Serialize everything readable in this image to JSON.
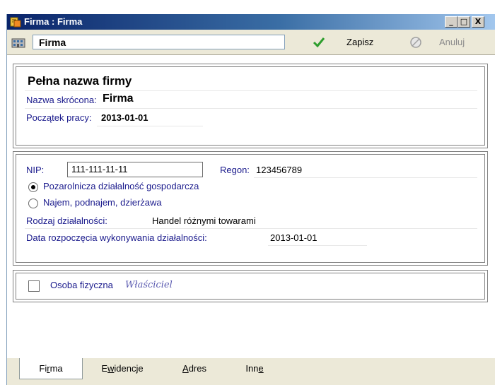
{
  "window": {
    "title": "Firma : Firma",
    "controls": [
      "_",
      "□",
      "X"
    ]
  },
  "toolbar": {
    "name_value": "Firma",
    "save_label": "Zapisz",
    "cancel_label": "Anuluj"
  },
  "company": {
    "full_name": "Pełna nazwa firmy",
    "short_name_label": "Nazwa skrócona:",
    "short_name_value": "Firma",
    "start_label": "Początek pracy:",
    "start_value": "2013-01-01"
  },
  "tax": {
    "nip_label": "NIP:",
    "nip_value": "111-111-11-11",
    "regon_label": "Regon:",
    "regon_value": "123456789",
    "options": [
      {
        "label": "Pozarolnicza działalność gospodarcza",
        "selected": true
      },
      {
        "label": "Najem, podnajem, dzierżawa",
        "selected": false
      }
    ],
    "activity_label": "Rodzaj działalności:",
    "activity_value": "Handel różnymi towarami",
    "activity_start_label": "Data rozpoczęcia wykonywania działalności:",
    "activity_start_value": "2013-01-01"
  },
  "person": {
    "label": "Osoba fizyczna",
    "owner_label": "Właściciel",
    "checked": false
  },
  "tabs": [
    {
      "label_pre": "Fi",
      "label_u": "r",
      "label_post": "ma",
      "active": true
    },
    {
      "label_pre": "E",
      "label_u": "w",
      "label_post": "idencje",
      "active": false
    },
    {
      "label_pre": "",
      "label_u": "A",
      "label_post": "dres",
      "active": false
    },
    {
      "label_pre": "Inn",
      "label_u": "e",
      "label_post": "",
      "active": false
    }
  ],
  "colors": {
    "label_blue": "#1a1a8c",
    "title_gradient_start": "#0a246a",
    "save_check": "#2e9e2e"
  }
}
